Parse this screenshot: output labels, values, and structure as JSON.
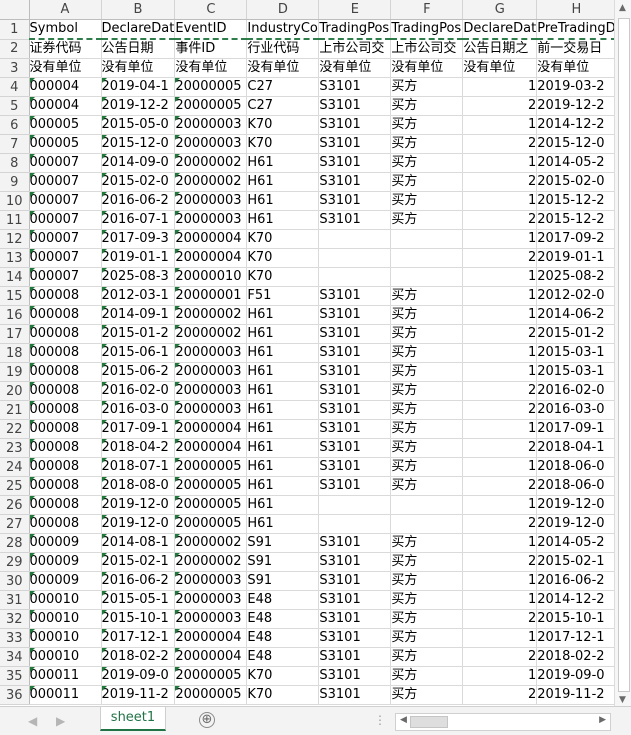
{
  "columns": [
    "A",
    "B",
    "C",
    "D",
    "E",
    "F",
    "G",
    "H"
  ],
  "header_row": [
    "Symbol",
    "DeclareDat",
    "EventID",
    "IndustryCo",
    "TradingPos",
    "TradingPos",
    "DeclareDat",
    "PreTradingD"
  ],
  "desc_row": [
    "证券代码",
    "公告日期",
    "事件ID",
    "行业代码",
    "上市公司交",
    "上市公司交",
    "公告日期之",
    "前一交易日"
  ],
  "unit_row": [
    "没有单位",
    "没有单位",
    "没有单位",
    "没有单位",
    "没有单位",
    "没有单位",
    "没有单位",
    "没有单位"
  ],
  "rows": [
    [
      "000004",
      "2019-04-1",
      "20000005",
      "C27",
      "S3101",
      "买方",
      "1",
      "2019-03-2"
    ],
    [
      "000004",
      "2019-12-2",
      "20000005",
      "C27",
      "S3101",
      "买方",
      "2",
      "2019-12-2"
    ],
    [
      "000005",
      "2015-05-0",
      "20000003",
      "K70",
      "S3101",
      "买方",
      "1",
      "2014-12-2"
    ],
    [
      "000005",
      "2015-12-0",
      "20000003",
      "K70",
      "S3101",
      "买方",
      "2",
      "2015-12-0"
    ],
    [
      "000007",
      "2014-09-0",
      "20000002",
      "H61",
      "S3101",
      "买方",
      "1",
      "2014-05-2"
    ],
    [
      "000007",
      "2015-02-0",
      "20000002",
      "H61",
      "S3101",
      "买方",
      "2",
      "2015-02-0"
    ],
    [
      "000007",
      "2016-06-2",
      "20000003",
      "H61",
      "S3101",
      "买方",
      "1",
      "2015-12-2"
    ],
    [
      "000007",
      "2016-07-1",
      "20000003",
      "H61",
      "S3101",
      "买方",
      "2",
      "2015-12-2"
    ],
    [
      "000007",
      "2017-09-3",
      "20000004",
      "K70",
      "",
      "",
      "1",
      "2017-09-2"
    ],
    [
      "000007",
      "2019-01-1",
      "20000004",
      "K70",
      "",
      "",
      "2",
      "2019-01-1"
    ],
    [
      "000007",
      "2025-08-3",
      "20000010",
      "K70",
      "",
      "",
      "1",
      "2025-08-2"
    ],
    [
      "000008",
      "2012-03-1",
      "20000001",
      "F51",
      "S3101",
      "买方",
      "1",
      "2012-02-0"
    ],
    [
      "000008",
      "2014-09-1",
      "20000002",
      "H61",
      "S3101",
      "买方",
      "1",
      "2014-06-2"
    ],
    [
      "000008",
      "2015-01-2",
      "20000002",
      "H61",
      "S3101",
      "买方",
      "2",
      "2015-01-2"
    ],
    [
      "000008",
      "2015-06-1",
      "20000003",
      "H61",
      "S3101",
      "买方",
      "1",
      "2015-03-1"
    ],
    [
      "000008",
      "2015-06-2",
      "20000003",
      "H61",
      "S3101",
      "买方",
      "1",
      "2015-03-1"
    ],
    [
      "000008",
      "2016-02-0",
      "20000003",
      "H61",
      "S3101",
      "买方",
      "2",
      "2016-02-0"
    ],
    [
      "000008",
      "2016-03-0",
      "20000003",
      "H61",
      "S3101",
      "买方",
      "2",
      "2016-03-0"
    ],
    [
      "000008",
      "2017-09-1",
      "20000004",
      "H61",
      "S3101",
      "买方",
      "1",
      "2017-09-1"
    ],
    [
      "000008",
      "2018-04-2",
      "20000004",
      "H61",
      "S3101",
      "买方",
      "2",
      "2018-04-1"
    ],
    [
      "000008",
      "2018-07-1",
      "20000005",
      "H61",
      "S3101",
      "买方",
      "1",
      "2018-06-0"
    ],
    [
      "000008",
      "2018-08-0",
      "20000005",
      "H61",
      "S3101",
      "买方",
      "2",
      "2018-06-0"
    ],
    [
      "000008",
      "2019-12-0",
      "20000005",
      "H61",
      "",
      "",
      "1",
      "2019-12-0"
    ],
    [
      "000008",
      "2019-12-0",
      "20000005",
      "H61",
      "",
      "",
      "2",
      "2019-12-0"
    ],
    [
      "000009",
      "2014-08-1",
      "20000002",
      "S91",
      "S3101",
      "买方",
      "1",
      "2014-05-2"
    ],
    [
      "000009",
      "2015-02-1",
      "20000002",
      "S91",
      "S3101",
      "买方",
      "2",
      "2015-02-1"
    ],
    [
      "000009",
      "2016-06-2",
      "20000003",
      "S91",
      "S3101",
      "买方",
      "1",
      "2016-06-2"
    ],
    [
      "000010",
      "2015-05-1",
      "20000003",
      "E48",
      "S3101",
      "买方",
      "1",
      "2014-12-2"
    ],
    [
      "000010",
      "2015-10-1",
      "20000003",
      "E48",
      "S3101",
      "买方",
      "2",
      "2015-10-1"
    ],
    [
      "000010",
      "2017-12-1",
      "20000004",
      "E48",
      "S3101",
      "买方",
      "1",
      "2017-12-1"
    ],
    [
      "000010",
      "2018-02-2",
      "20000004",
      "E48",
      "S3101",
      "买方",
      "2",
      "2018-02-2"
    ],
    [
      "000011",
      "2019-09-0",
      "20000005",
      "K70",
      "S3101",
      "买方",
      "1",
      "2019-09-0"
    ],
    [
      "000011",
      "2019-11-2",
      "20000005",
      "K70",
      "S3101",
      "买方",
      "2",
      "2019-11-2"
    ]
  ],
  "sheet_tab": "sheet1",
  "add_sheet_symbol": "⊕",
  "tab_dots": "⋮"
}
